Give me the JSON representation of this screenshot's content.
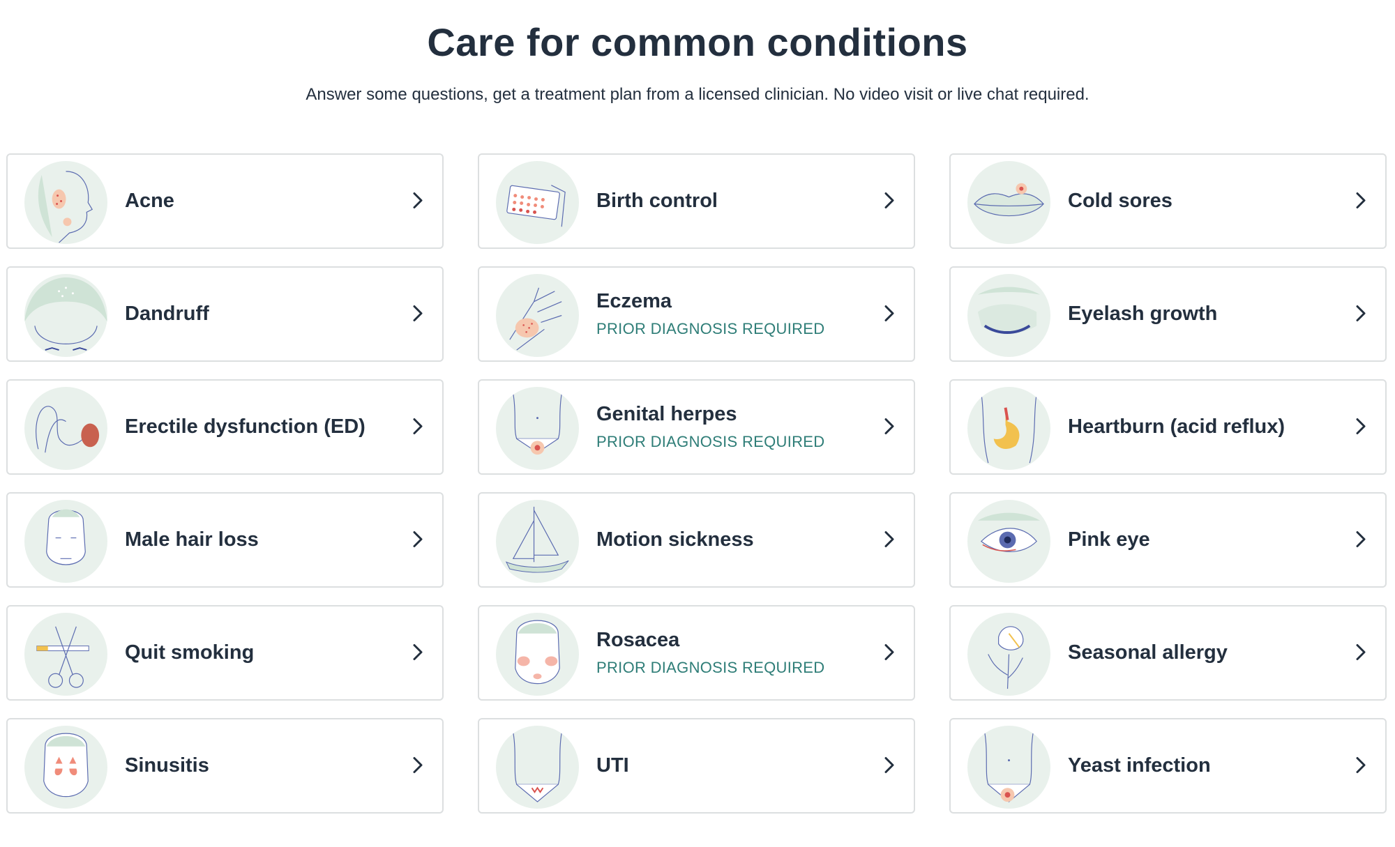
{
  "header": {
    "title": "Care for common conditions",
    "subtitle": "Answer some questions, get a treatment plan from a licensed clinician. No video visit or live chat required."
  },
  "colors": {
    "text": "#232f3e",
    "badge": "#2e7d77",
    "icon_bg": "#e9f1ec",
    "border": "#dcdfe0"
  },
  "conditions": [
    {
      "name": "Acne",
      "badge": "",
      "icon": "acne-face-icon"
    },
    {
      "name": "Birth control",
      "badge": "",
      "icon": "pill-pack-icon"
    },
    {
      "name": "Cold sores",
      "badge": "",
      "icon": "lips-icon"
    },
    {
      "name": "Dandruff",
      "badge": "",
      "icon": "scalp-icon"
    },
    {
      "name": "Eczema",
      "badge": "PRIOR DIAGNOSIS REQUIRED",
      "icon": "hand-rash-icon"
    },
    {
      "name": "Eyelash growth",
      "badge": "",
      "icon": "closed-eye-icon"
    },
    {
      "name": "Erectile dysfunction (ED)",
      "badge": "",
      "icon": "ed-icon"
    },
    {
      "name": "Genital herpes",
      "badge": "PRIOR DIAGNOSIS REQUIRED",
      "icon": "pelvis-spot-icon"
    },
    {
      "name": "Heartburn (acid reflux)",
      "badge": "",
      "icon": "stomach-icon"
    },
    {
      "name": "Male hair loss",
      "badge": "",
      "icon": "male-face-icon"
    },
    {
      "name": "Motion sickness",
      "badge": "",
      "icon": "sailboat-icon"
    },
    {
      "name": "Pink eye",
      "badge": "",
      "icon": "eye-icon"
    },
    {
      "name": "Quit smoking",
      "badge": "",
      "icon": "scissors-cigarette-icon"
    },
    {
      "name": "Rosacea",
      "badge": "PRIOR DIAGNOSIS REQUIRED",
      "icon": "flushed-face-icon"
    },
    {
      "name": "Seasonal allergy",
      "badge": "",
      "icon": "flower-icon"
    },
    {
      "name": "Sinusitis",
      "badge": "",
      "icon": "sinus-face-icon"
    },
    {
      "name": "UTI",
      "badge": "",
      "icon": "lower-torso-icon"
    },
    {
      "name": "Yeast infection",
      "badge": "",
      "icon": "torso-spot-icon"
    }
  ]
}
